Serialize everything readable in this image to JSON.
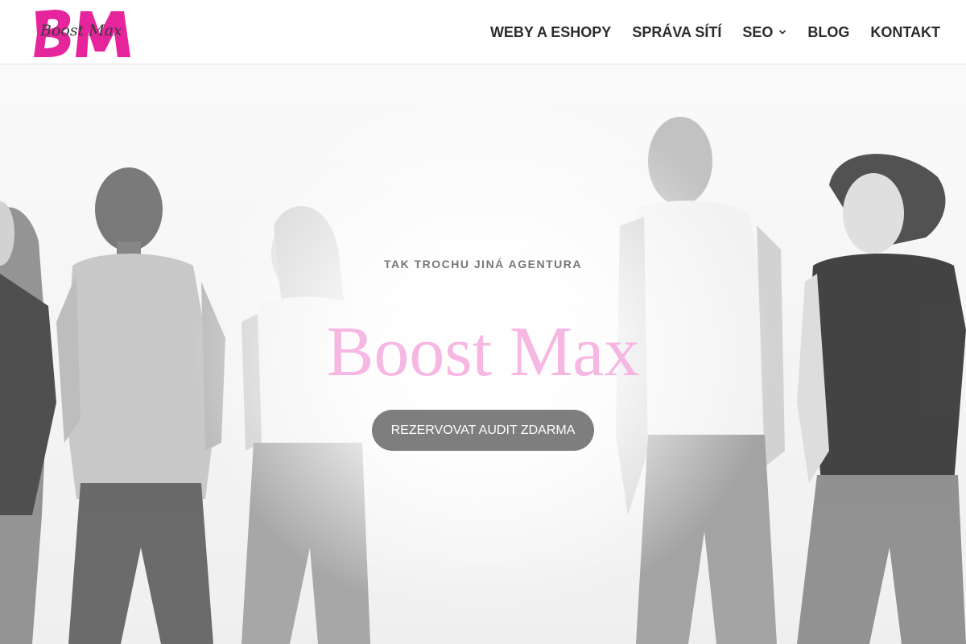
{
  "brand": {
    "logo_initials": "BM",
    "logo_script": "Boost Max",
    "logo_color": "#e6249c"
  },
  "nav": {
    "items": [
      {
        "label": "WEBY A ESHOPY",
        "has_dropdown": false
      },
      {
        "label": "SPRÁVA SÍTÍ",
        "has_dropdown": false
      },
      {
        "label": "SEO",
        "has_dropdown": true
      },
      {
        "label": "BLOG",
        "has_dropdown": false
      },
      {
        "label": "KONTAKT",
        "has_dropdown": false
      }
    ]
  },
  "hero": {
    "tagline": "TAK TROCHU JINÁ AGENTURA",
    "title": "Boost Max",
    "title_color": "#f6b7e3",
    "cta_label": "REZERVOVAT AUDIT ZDARMA",
    "cta_color": "#7e7e7e"
  }
}
